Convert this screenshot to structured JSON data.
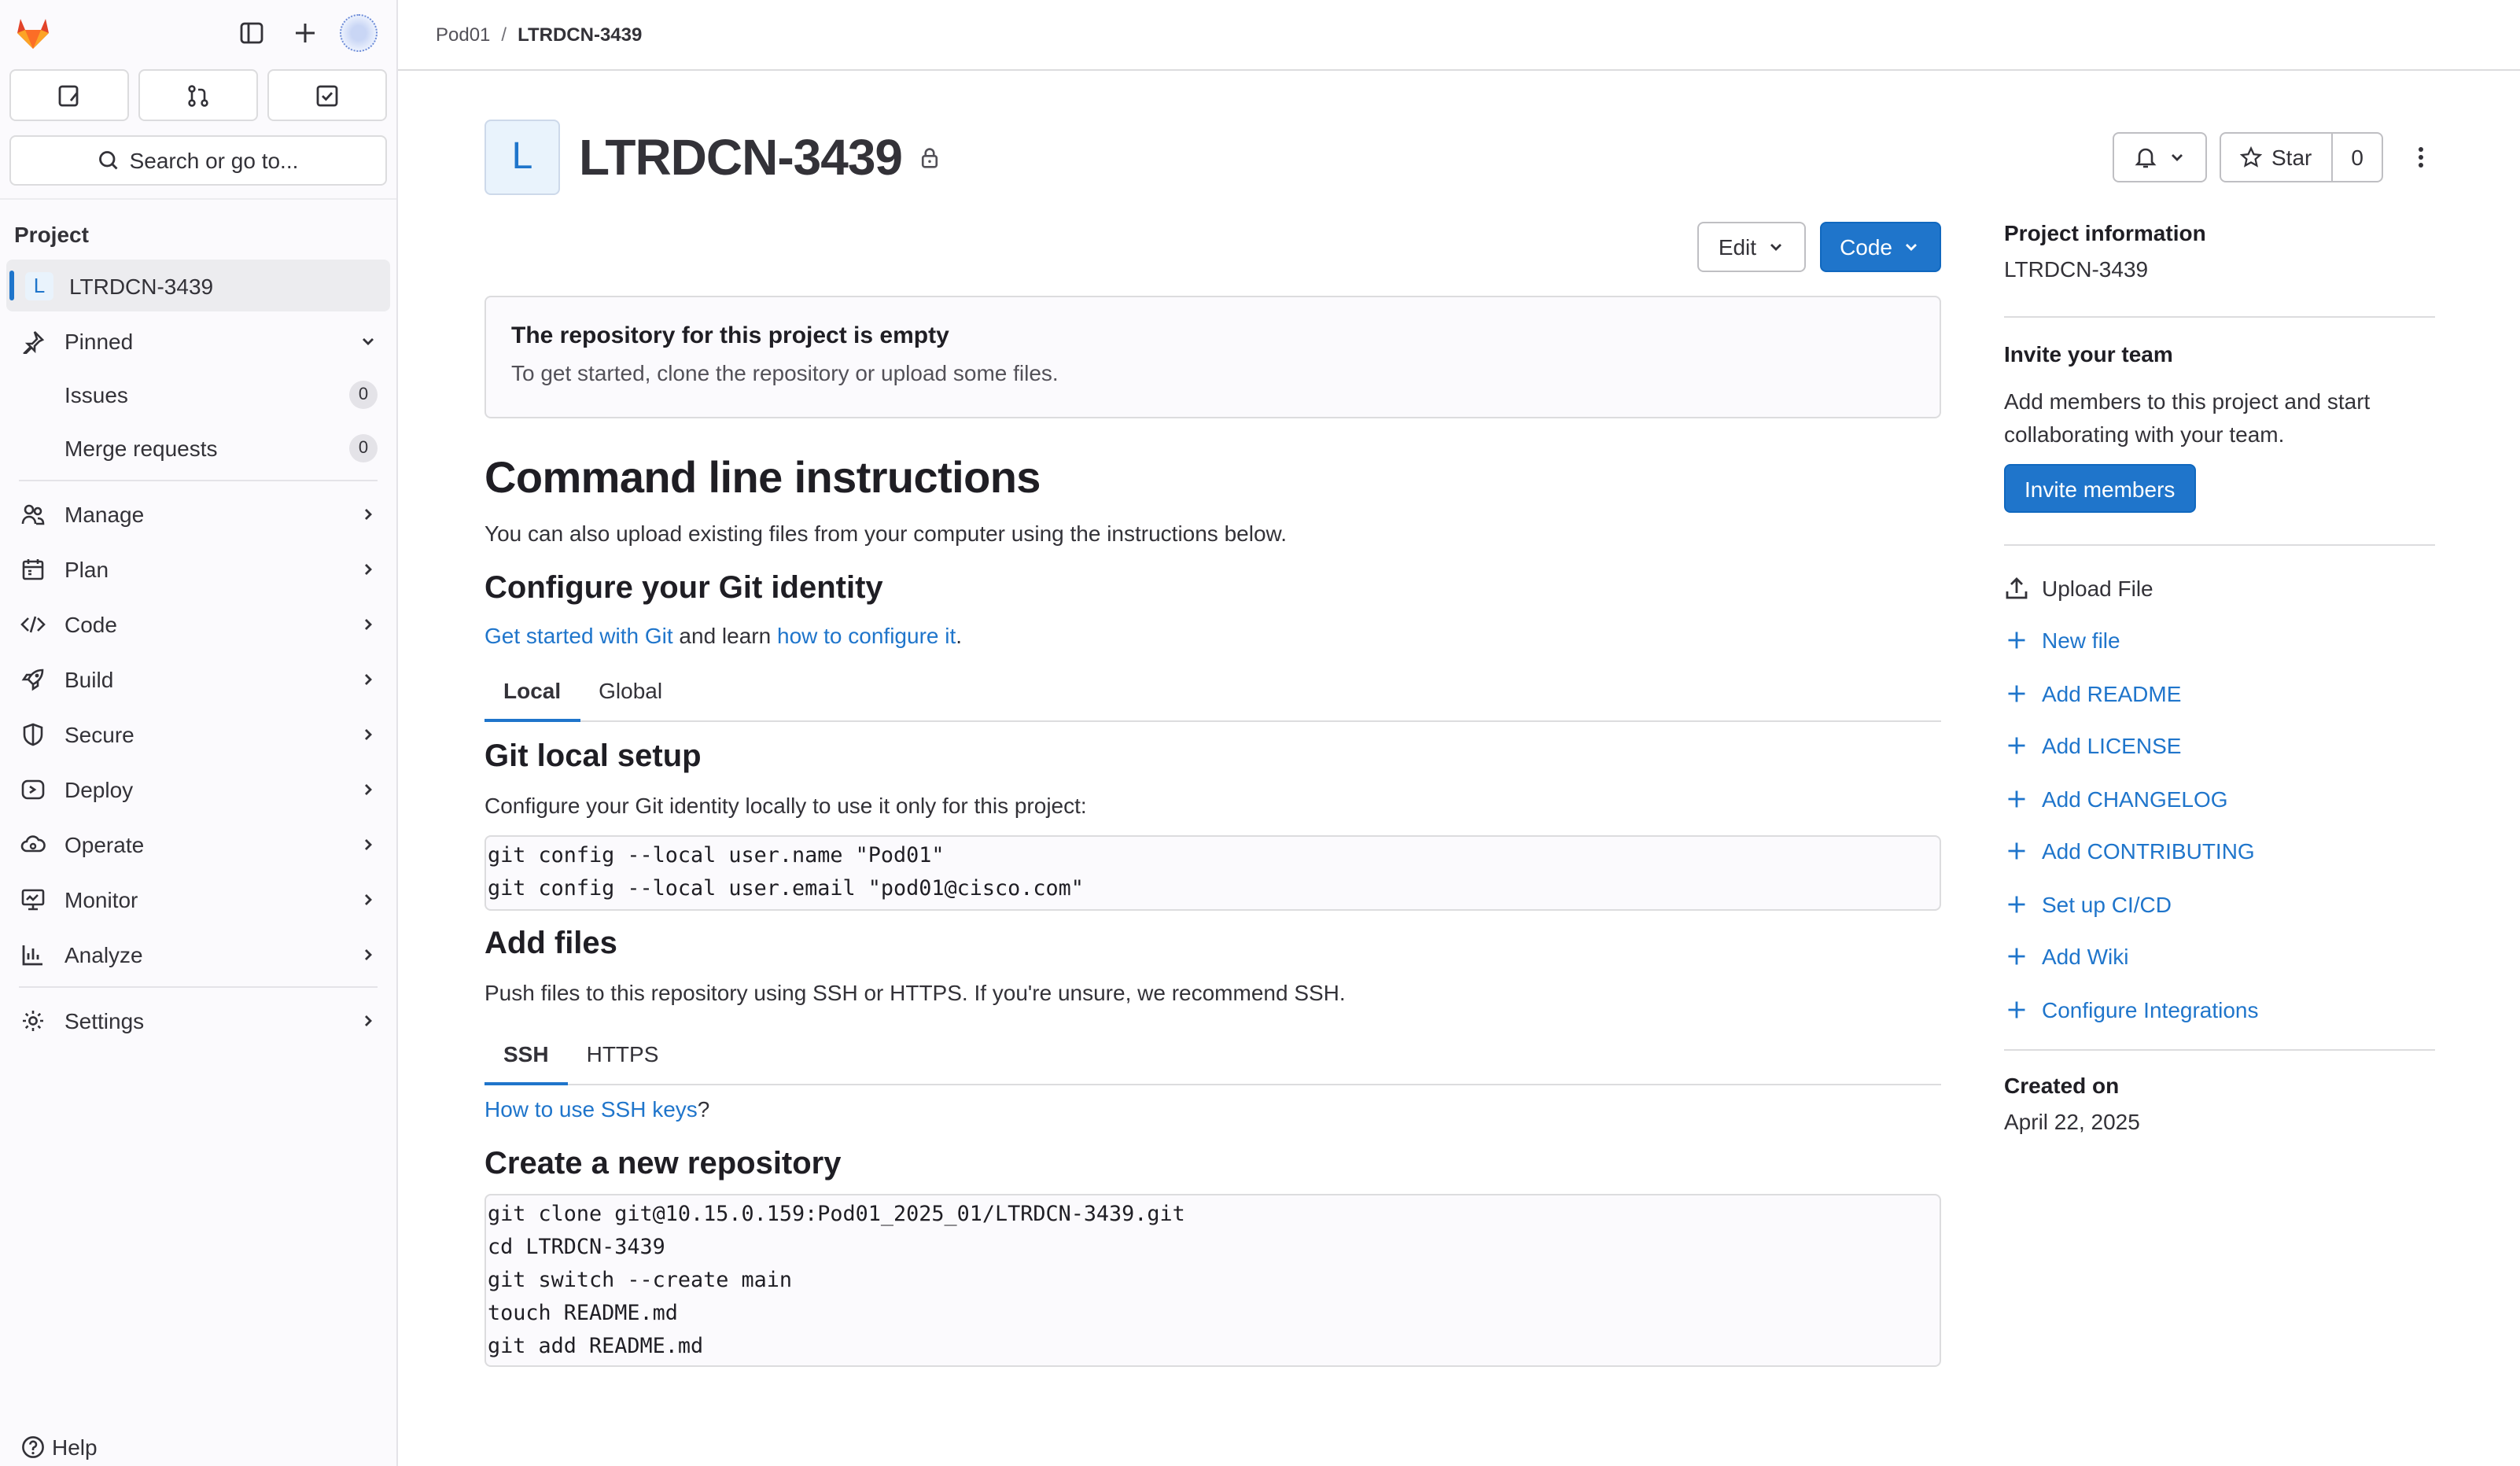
{
  "sidebar": {
    "search_label": "Search or go to...",
    "section_title": "Project",
    "project_letter": "L",
    "project_name": "LTRDCN-3439",
    "pinned_label": "Pinned",
    "pinned_items": [
      {
        "label": "Issues",
        "count": "0"
      },
      {
        "label": "Merge requests",
        "count": "0"
      }
    ],
    "nav": [
      {
        "label": "Manage",
        "icon": "users-icon"
      },
      {
        "label": "Plan",
        "icon": "calendar-icon"
      },
      {
        "label": "Code",
        "icon": "code-icon"
      },
      {
        "label": "Build",
        "icon": "rocket-icon"
      },
      {
        "label": "Secure",
        "icon": "shield-icon"
      },
      {
        "label": "Deploy",
        "icon": "deploy-icon"
      },
      {
        "label": "Operate",
        "icon": "cloud-gear-icon"
      },
      {
        "label": "Monitor",
        "icon": "monitor-icon"
      },
      {
        "label": "Analyze",
        "icon": "chart-icon"
      }
    ],
    "settings_label": "Settings",
    "help_label": "Help"
  },
  "breadcrumb": {
    "parent": "Pod01",
    "separator": "/",
    "current": "LTRDCN-3439"
  },
  "project": {
    "avatar_letter": "L",
    "title": "LTRDCN-3439",
    "star_label": "Star",
    "star_count": "0",
    "edit_label": "Edit",
    "code_label": "Code"
  },
  "empty_notice": {
    "title": "The repository for this project is empty",
    "text": "To get started, clone the repository or upload some files."
  },
  "instructions": {
    "heading": "Command line instructions",
    "intro": "You can also upload existing files from your computer using the instructions below.",
    "identity_heading": "Configure your Git identity",
    "identity_link1": "Get started with Git",
    "identity_mid": " and learn ",
    "identity_link2": "how to configure it",
    "identity_end": ".",
    "identity_tabs": [
      "Local",
      "Global"
    ],
    "local_heading": "Git local setup",
    "local_text": "Configure your Git identity locally to use it only for this project:",
    "local_code": "git config --local user.name \"Pod01\"\ngit config --local user.email \"pod01@cisco.com\"",
    "add_heading": "Add files",
    "add_text": "Push files to this repository using SSH or HTTPS. If you're unsure, we recommend SSH.",
    "protocol_tabs": [
      "SSH",
      "HTTPS"
    ],
    "ssh_link": "How to use SSH keys",
    "ssh_end": "?",
    "new_repo_heading": "Create a new repository",
    "new_repo_code": "git clone git@10.15.0.159:Pod01_2025_01/LTRDCN-3439.git\ncd LTRDCN-3439\ngit switch --create main\ntouch README.md\ngit add README.md"
  },
  "right_panel": {
    "info_heading": "Project information",
    "info_name": "LTRDCN-3439",
    "invite_heading": "Invite your team",
    "invite_text": "Add members to this project and start collaborating with your team.",
    "invite_button": "Invite members",
    "upload_label": "Upload File",
    "links": [
      "New file",
      "Add README",
      "Add LICENSE",
      "Add CHANGELOG",
      "Add CONTRIBUTING",
      "Set up CI/CD",
      "Add Wiki",
      "Configure Integrations"
    ],
    "created_heading": "Created on",
    "created_date": "April 22, 2025"
  },
  "colors": {
    "accent": "#1f75cb",
    "logo": "#e24329"
  }
}
